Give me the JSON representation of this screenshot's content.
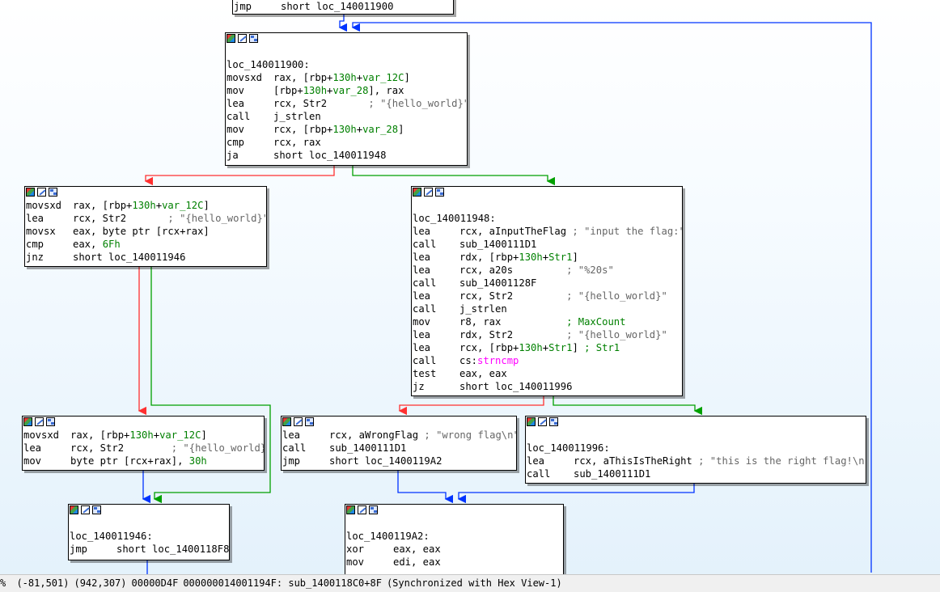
{
  "top_node": {
    "mnem": "jmp",
    "op": "short loc_140011900"
  },
  "blocks": [
    {
      "id": "b900",
      "lines": [
        {
          "label": "loc_140011900:"
        },
        {
          "m": "movsxd",
          "o": [
            [
              "rax, [rbp+",
              ""
            ],
            [
              "130h",
              "num"
            ],
            [
              "+",
              ""
            ],
            [
              "var_12C",
              "num"
            ],
            [
              "]",
              ""
            ]
          ]
        },
        {
          "m": "mov",
          "o": [
            [
              "[rbp+",
              ""
            ],
            [
              "130h",
              "num"
            ],
            [
              "+",
              ""
            ],
            [
              "var_28",
              "num"
            ],
            [
              "], rax",
              ""
            ]
          ]
        },
        {
          "m": "lea",
          "o": [
            [
              "rcx, Str2       ",
              ""
            ],
            [
              "; \"{hello_world}\"",
              "cmt"
            ]
          ]
        },
        {
          "m": "call",
          "o": [
            [
              "j_strlen",
              ""
            ]
          ]
        },
        {
          "m": "mov",
          "o": [
            [
              "rcx, [rbp+",
              ""
            ],
            [
              "130h",
              "num"
            ],
            [
              "+",
              ""
            ],
            [
              "var_28",
              "num"
            ],
            [
              "]",
              ""
            ]
          ]
        },
        {
          "m": "cmp",
          "o": [
            [
              "rcx, rax",
              ""
            ]
          ]
        },
        {
          "m": "ja",
          "o": [
            [
              "short loc_140011948",
              ""
            ]
          ]
        }
      ]
    },
    {
      "id": "bleft",
      "lines": [
        {
          "m": "movsxd",
          "o": [
            [
              "rax, [rbp+",
              ""
            ],
            [
              "130h",
              "num"
            ],
            [
              "+",
              ""
            ],
            [
              "var_12C",
              "num"
            ],
            [
              "]",
              ""
            ]
          ]
        },
        {
          "m": "lea",
          "o": [
            [
              "rcx, Str2       ",
              ""
            ],
            [
              "; \"{hello_world}\"",
              "cmt"
            ]
          ]
        },
        {
          "m": "movsx",
          "o": [
            [
              "eax, byte ptr [rcx+rax]",
              ""
            ]
          ]
        },
        {
          "m": "cmp",
          "o": [
            [
              "eax, ",
              ""
            ],
            [
              "6Fh",
              "num"
            ]
          ]
        },
        {
          "m": "jnz",
          "o": [
            [
              "short loc_140011946",
              ""
            ]
          ]
        }
      ]
    },
    {
      "id": "b948",
      "lines": [
        {
          "label": "loc_140011948:"
        },
        {
          "m": "lea",
          "o": [
            [
              "rcx, aInputTheFlag ",
              ""
            ],
            [
              "; \"input the flag:\"",
              "cmt"
            ]
          ]
        },
        {
          "m": "call",
          "o": [
            [
              "sub_1400111D1",
              ""
            ]
          ]
        },
        {
          "m": "lea",
          "o": [
            [
              "rdx, [rbp+",
              ""
            ],
            [
              "130h",
              "num"
            ],
            [
              "+",
              ""
            ],
            [
              "Str1",
              "num"
            ],
            [
              "]",
              ""
            ]
          ]
        },
        {
          "m": "lea",
          "o": [
            [
              "rcx, a20s         ",
              ""
            ],
            [
              "; \"%20s\"",
              "cmt"
            ]
          ]
        },
        {
          "m": "call",
          "o": [
            [
              "sub_14001128F",
              ""
            ]
          ]
        },
        {
          "m": "lea",
          "o": [
            [
              "rcx, Str2         ",
              ""
            ],
            [
              "; \"{hello_world}\"",
              "cmt"
            ]
          ]
        },
        {
          "m": "call",
          "o": [
            [
              "j_strlen",
              ""
            ]
          ]
        },
        {
          "m": "mov",
          "o": [
            [
              "r8, rax           ",
              ""
            ],
            [
              "; MaxCount",
              "num"
            ]
          ]
        },
        {
          "m": "lea",
          "o": [
            [
              "rdx, Str2         ",
              ""
            ],
            [
              "; \"{hello_world}\"",
              "cmt"
            ]
          ]
        },
        {
          "m": "lea",
          "o": [
            [
              "rcx, [rbp+",
              ""
            ],
            [
              "130h",
              "num"
            ],
            [
              "+",
              ""
            ],
            [
              "Str1",
              "num"
            ],
            [
              "] ",
              ""
            ],
            [
              "; Str1",
              "num"
            ]
          ]
        },
        {
          "m": "call",
          "o": [
            [
              "cs:",
              ""
            ],
            [
              "strncmp",
              "fn"
            ]
          ]
        },
        {
          "m": "test",
          "o": [
            [
              "eax, eax",
              ""
            ]
          ]
        },
        {
          "m": "jz",
          "o": [
            [
              "short loc_140011996",
              ""
            ]
          ]
        }
      ]
    },
    {
      "id": "bmov",
      "lines": [
        {
          "m": "movsxd",
          "o": [
            [
              "rax, [rbp+",
              ""
            ],
            [
              "130h",
              "num"
            ],
            [
              "+",
              ""
            ],
            [
              "var_12C",
              "num"
            ],
            [
              "]",
              ""
            ]
          ]
        },
        {
          "m": "lea",
          "o": [
            [
              "rcx, Str2        ",
              ""
            ],
            [
              "; \"{hello_world}\"",
              "cmt"
            ]
          ]
        },
        {
          "m": "mov",
          "o": [
            [
              "byte ptr [rcx+rax], ",
              ""
            ],
            [
              "30h",
              "num"
            ]
          ]
        }
      ]
    },
    {
      "id": "bwrong",
      "lines": [
        {
          "m": "lea",
          "o": [
            [
              "rcx, aWrongFlag ",
              ""
            ],
            [
              "; \"wrong flag\\n\"",
              "cmt"
            ]
          ]
        },
        {
          "m": "call",
          "o": [
            [
              "sub_1400111D1",
              ""
            ]
          ]
        },
        {
          "m": "jmp",
          "o": [
            [
              "short loc_1400119A2",
              ""
            ]
          ]
        }
      ]
    },
    {
      "id": "b996",
      "lines": [
        {
          "label": "loc_140011996:"
        },
        {
          "m": "lea",
          "o": [
            [
              "rcx, aThisIsTheRight ",
              ""
            ],
            [
              "; \"this is the right flag!\\n\"",
              "cmt"
            ]
          ]
        },
        {
          "m": "call",
          "o": [
            [
              "sub_1400111D1",
              ""
            ]
          ]
        }
      ]
    },
    {
      "id": "b946",
      "lines": [
        {
          "label": "loc_140011946:"
        },
        {
          "m": "jmp",
          "o": [
            [
              "short loc_1400118F8",
              ""
            ]
          ]
        }
      ]
    },
    {
      "id": "b9a2",
      "lines": [
        {
          "label": "loc_1400119A2:"
        },
        {
          "m": "xor",
          "o": [
            [
              "eax, eax",
              ""
            ]
          ]
        },
        {
          "m": "mov",
          "o": [
            [
              "edi, eax",
              ""
            ]
          ]
        }
      ]
    }
  ],
  "statusbar": {
    "zoom": "% ",
    "mouse": "(-81,501)",
    "graph_pos": "(942,307)",
    "offset": "00000D4F",
    "address": "000000014001194F: sub_1400118C0+8F",
    "sync": "(Synchronized with Hex View-1)"
  },
  "colors": {
    "true_edge": "#00a000",
    "false_edge": "#ff3030",
    "uncond_edge": "#0033ff"
  }
}
